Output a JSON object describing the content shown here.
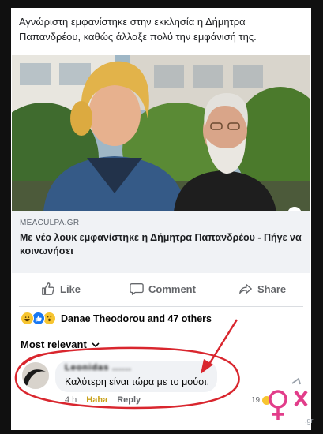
{
  "post": {
    "caption": "Αγνώριστη εμφανίστηκε στην εκκλησία η Δήμητρα Παπανδρέου, καθώς άλλαξε πολύ την εμφάνισή της."
  },
  "link": {
    "domain": "MEACULPA.GR",
    "title": "Με νέο λουκ εμφανίστηκε η Δήμητρα Παπανδρέου - Πήγε να κοινωνήσει",
    "info_icon": "i"
  },
  "actions": {
    "like": "Like",
    "comment": "Comment",
    "share": "Share"
  },
  "reactions": {
    "icons": [
      "haha-icon",
      "like-icon",
      "wow-icon"
    ],
    "summary": "Danae Theodorou and 47 others"
  },
  "comments": {
    "sort_label": "Most relevant",
    "items": [
      {
        "author": "Leonidas ......",
        "text": "Καλύτερη είναι τώρα με το μούσι.",
        "time": "4 h",
        "reaction_link": "Haha",
        "reply_link": "Reply",
        "reaction_count": "19"
      }
    ]
  },
  "colors": {
    "annotation": "#d9262e",
    "link_bg": "#f0f2f5",
    "muted_text": "#65676b"
  }
}
